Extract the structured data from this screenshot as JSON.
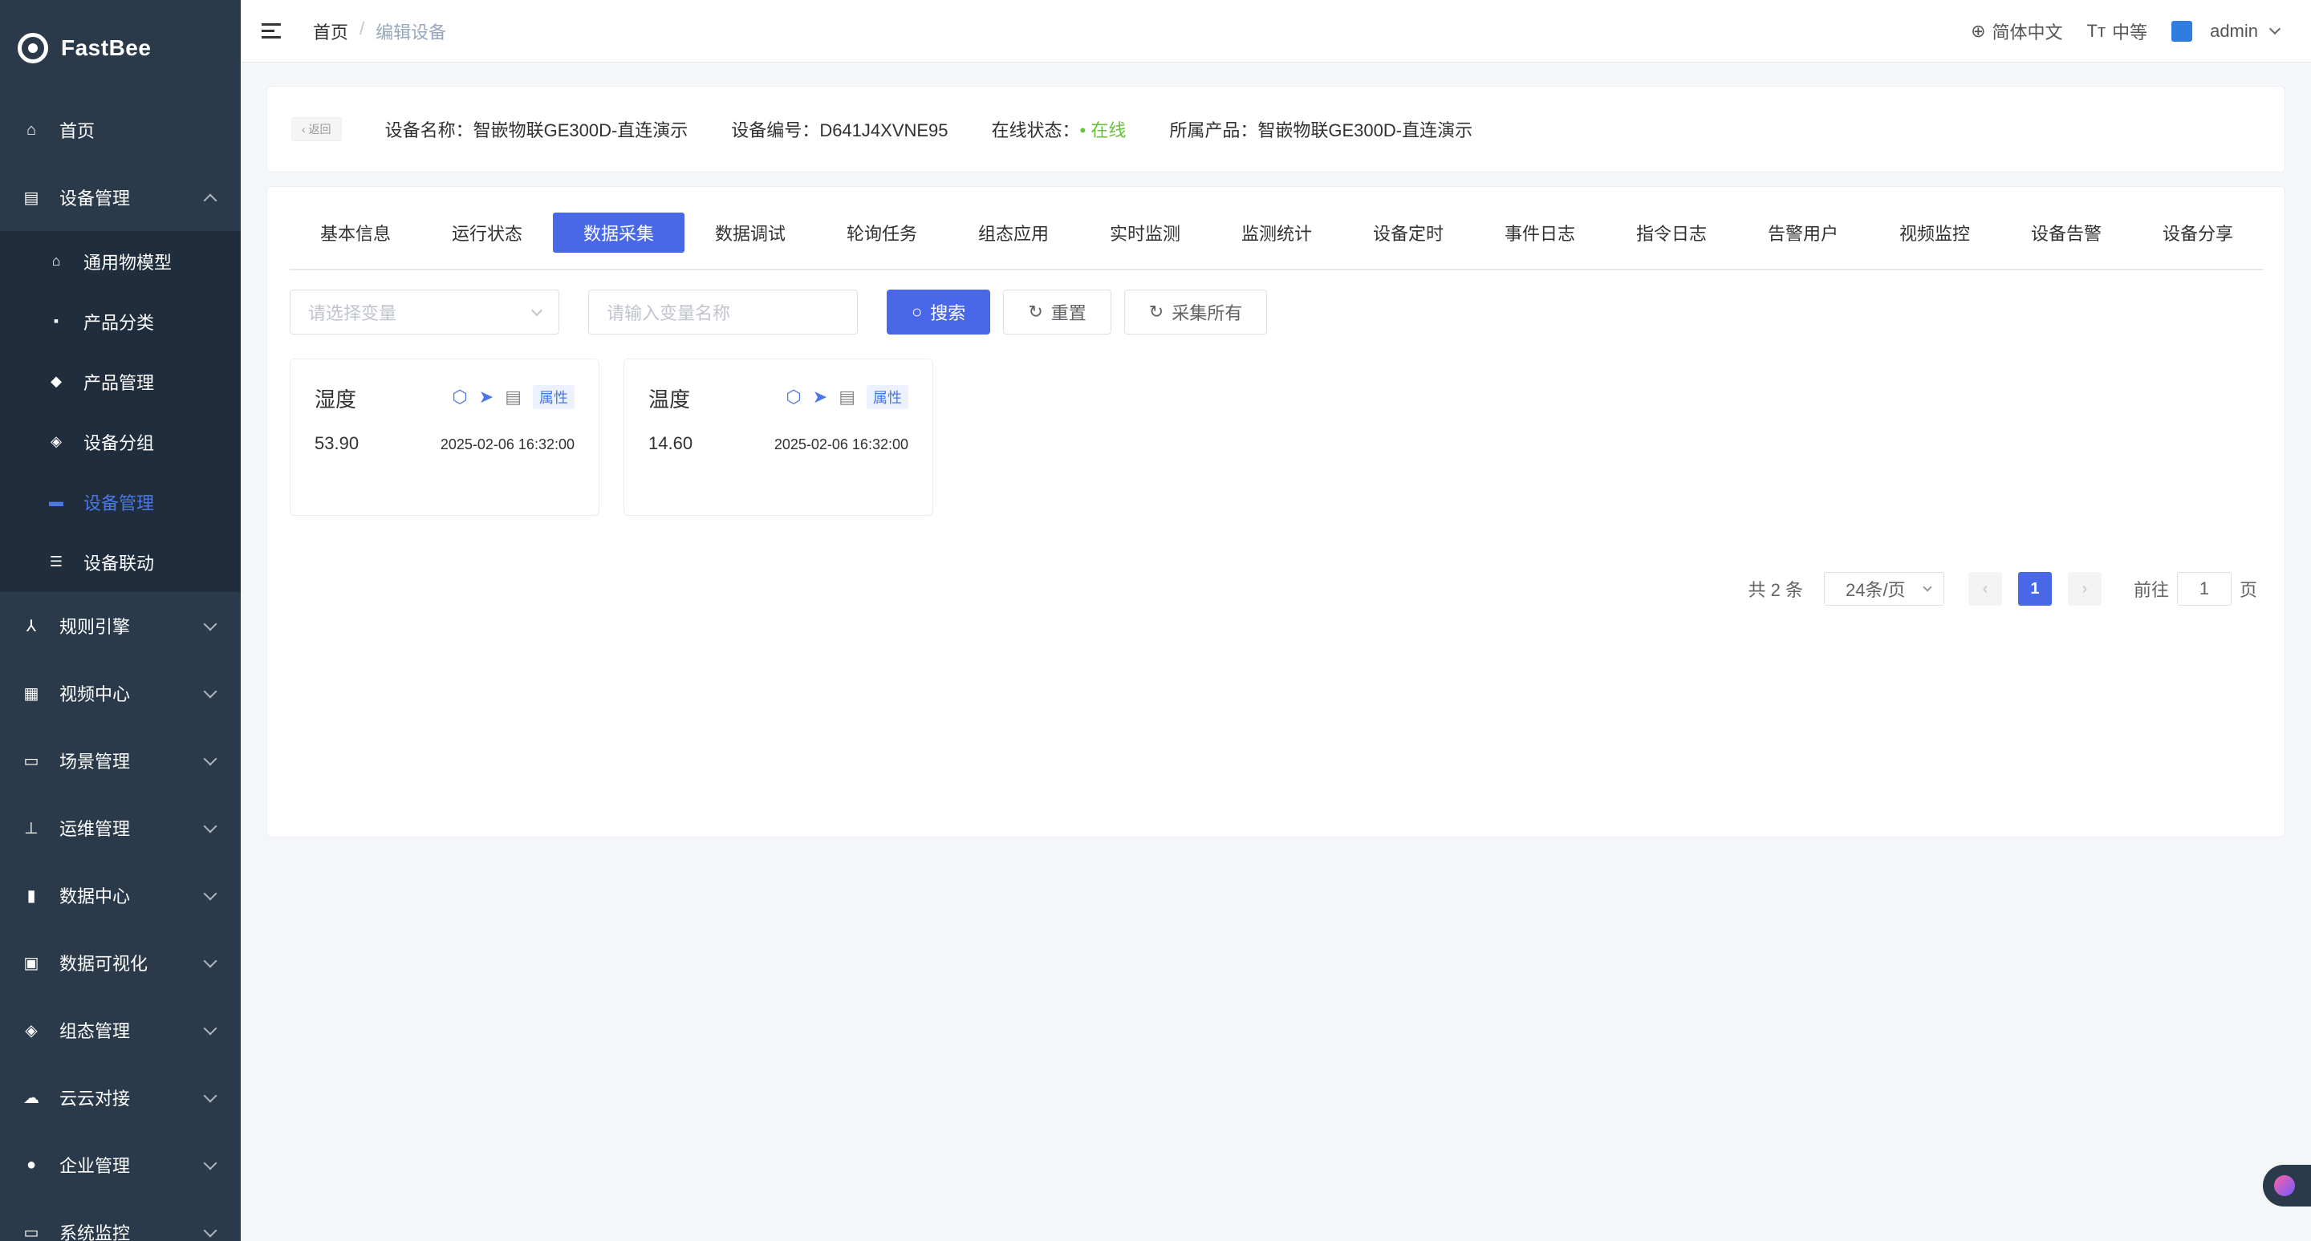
{
  "app": {
    "name": "FastBee"
  },
  "sidebar": {
    "items": [
      {
        "label": "首页",
        "icon": "home-icon"
      },
      {
        "label": "设备管理",
        "icon": "device-icon",
        "expanded": true,
        "children": [
          {
            "label": "通用物模型",
            "icon": "model-icon"
          },
          {
            "label": "产品分类",
            "icon": "category-icon"
          },
          {
            "label": "产品管理",
            "icon": "product-icon"
          },
          {
            "label": "设备分组",
            "icon": "group-icon"
          },
          {
            "label": "设备管理",
            "icon": "device-manage-icon",
            "active": true
          },
          {
            "label": "设备联动",
            "icon": "linkage-icon"
          }
        ]
      },
      {
        "label": "规则引擎",
        "icon": "rule-icon"
      },
      {
        "label": "视频中心",
        "icon": "video-icon"
      },
      {
        "label": "场景管理",
        "icon": "scene-icon"
      },
      {
        "label": "运维管理",
        "icon": "ops-icon"
      },
      {
        "label": "数据中心",
        "icon": "data-icon"
      },
      {
        "label": "数据可视化",
        "icon": "visual-icon"
      },
      {
        "label": "组态管理",
        "icon": "config-icon"
      },
      {
        "label": "云云对接",
        "icon": "cloud-icon"
      },
      {
        "label": "企业管理",
        "icon": "enterprise-icon"
      },
      {
        "label": "系统监控",
        "icon": "monitor-icon"
      }
    ]
  },
  "header": {
    "breadcrumb": [
      "首页",
      "编辑设备"
    ],
    "separator": "/",
    "language": "简体中文",
    "font_size": "中等",
    "user": "admin"
  },
  "device_info": {
    "back_label": "返回",
    "name_label": "设备名称：",
    "name": "智嵌物联GE300D-直连演示",
    "serial_label": "设备编号：",
    "serial": "D641J4XVNE95",
    "status_label": "在线状态：",
    "status": "• 在线",
    "product_label": "所属产品：",
    "product": "智嵌物联GE300D-直连演示"
  },
  "tabs": [
    "基本信息",
    "运行状态",
    "数据采集",
    "数据调试",
    "轮询任务",
    "组态应用",
    "实时监测",
    "监测统计",
    "设备定时",
    "事件日志",
    "指令日志",
    "告警用户",
    "视频监控",
    "设备告警",
    "设备分享"
  ],
  "active_tab_index": 2,
  "filters": {
    "variable_select_placeholder": "请选择变量",
    "variable_name_placeholder": "请输入变量名称",
    "search_label": "搜索",
    "reset_label": "重置",
    "collect_all_label": "采集所有"
  },
  "variables": [
    {
      "name": "湿度",
      "tag": "属性",
      "value": "53.90",
      "time": "2025-02-06 16:32:00"
    },
    {
      "name": "温度",
      "tag": "属性",
      "value": "14.60",
      "time": "2025-02-06 16:32:00"
    }
  ],
  "pagination": {
    "total_text": "共 2 条",
    "page_size": "24条/页",
    "current_page": "1",
    "goto_prefix": "前往",
    "goto_value": "1",
    "goto_suffix": "页"
  },
  "colors": {
    "primary": "#4868e8",
    "sidebar": "#2b3a4a",
    "online": "#67c23a"
  }
}
